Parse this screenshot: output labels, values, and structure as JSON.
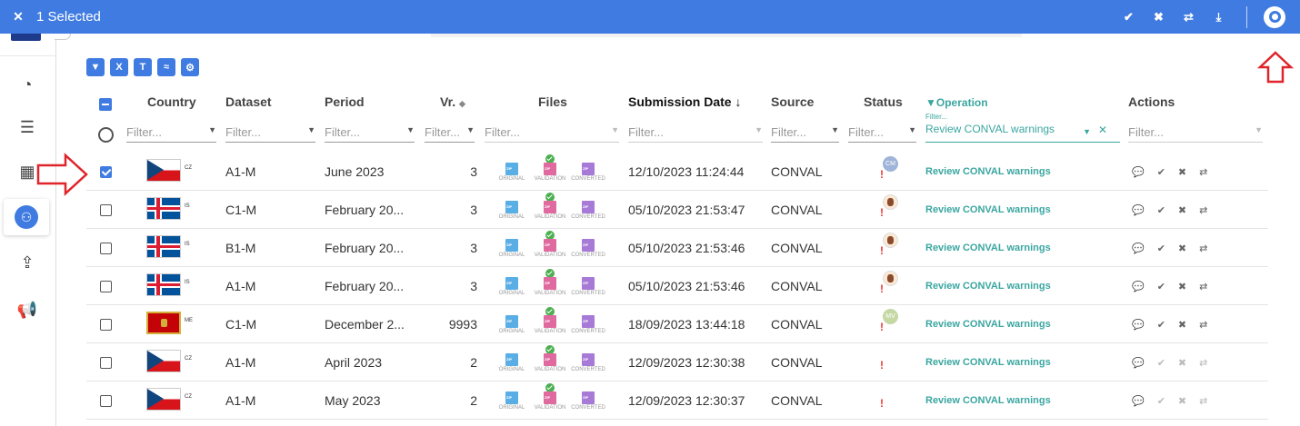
{
  "topbar": {
    "close_icon": "close-icon",
    "title": "1 Selected",
    "actions": [
      "check-icon",
      "close-icon",
      "swap-icon",
      "download-icon"
    ]
  },
  "sidebar": {
    "items": [
      "dashboard-icon",
      "stack-icon",
      "calculator-icon",
      "hub-icon",
      "upload-icon",
      "megaphone-icon"
    ],
    "active_index": 3
  },
  "toolbar": {
    "buttons": [
      "filter-reset-icon",
      "excel-icon",
      "text-icon",
      "collapse-icon",
      "settings-icon"
    ]
  },
  "columns": {
    "country": "Country",
    "dataset": "Dataset",
    "period": "Period",
    "version": "Vr.",
    "files": "Files",
    "submission_date": "Submission Date",
    "source": "Source",
    "status": "Status",
    "operation": "Operation",
    "actions": "Actions"
  },
  "filters": {
    "placeholder": "Filter...",
    "operation_label": "Filter...",
    "operation_value": "Review CONVAL warnings"
  },
  "file_labels": [
    "ORIGINAL",
    "VALIDATION",
    "CONVERTED"
  ],
  "rows": [
    {
      "checked": true,
      "flag": "cz",
      "code": "CZ",
      "dataset": "A1-M",
      "period": "June 2023",
      "version": "3",
      "date": "12/10/2023 11:24:44",
      "source": "CONVAL",
      "avatar": "CM",
      "operation": "Review CONVAL warnings",
      "actions_enabled": true
    },
    {
      "checked": false,
      "flag": "is",
      "code": "IS",
      "dataset": "C1-M",
      "period": "February 20...",
      "version": "3",
      "date": "05/10/2023 21:53:47",
      "source": "CONVAL",
      "avatar": "person",
      "operation": "Review CONVAL warnings",
      "actions_enabled": true
    },
    {
      "checked": false,
      "flag": "is",
      "code": "IS",
      "dataset": "B1-M",
      "period": "February 20...",
      "version": "3",
      "date": "05/10/2023 21:53:46",
      "source": "CONVAL",
      "avatar": "person",
      "operation": "Review CONVAL warnings",
      "actions_enabled": true
    },
    {
      "checked": false,
      "flag": "is",
      "code": "IS",
      "dataset": "A1-M",
      "period": "February 20...",
      "version": "3",
      "date": "05/10/2023 21:53:46",
      "source": "CONVAL",
      "avatar": "person",
      "operation": "Review CONVAL warnings",
      "actions_enabled": true
    },
    {
      "checked": false,
      "flag": "me",
      "code": "ME",
      "dataset": "C1-M",
      "period": "December 2...",
      "version": "9993",
      "date": "18/09/2023 13:44:18",
      "source": "CONVAL",
      "avatar": "MV",
      "operation": "Review CONVAL warnings",
      "actions_enabled": true
    },
    {
      "checked": false,
      "flag": "cz",
      "code": "CZ",
      "dataset": "A1-M",
      "period": "April 2023",
      "version": "2",
      "date": "12/09/2023 12:30:38",
      "source": "CONVAL",
      "avatar": "",
      "operation": "Review CONVAL warnings",
      "actions_enabled": false
    },
    {
      "checked": false,
      "flag": "cz",
      "code": "CZ",
      "dataset": "A1-M",
      "period": "May 2023",
      "version": "2",
      "date": "12/09/2023 12:30:37",
      "source": "CONVAL",
      "avatar": "",
      "operation": "Review CONVAL warnings",
      "actions_enabled": false
    }
  ],
  "colors": {
    "accent": "#3f7be0",
    "operation": "#3aa6a0",
    "arrow": "#e0242b"
  }
}
